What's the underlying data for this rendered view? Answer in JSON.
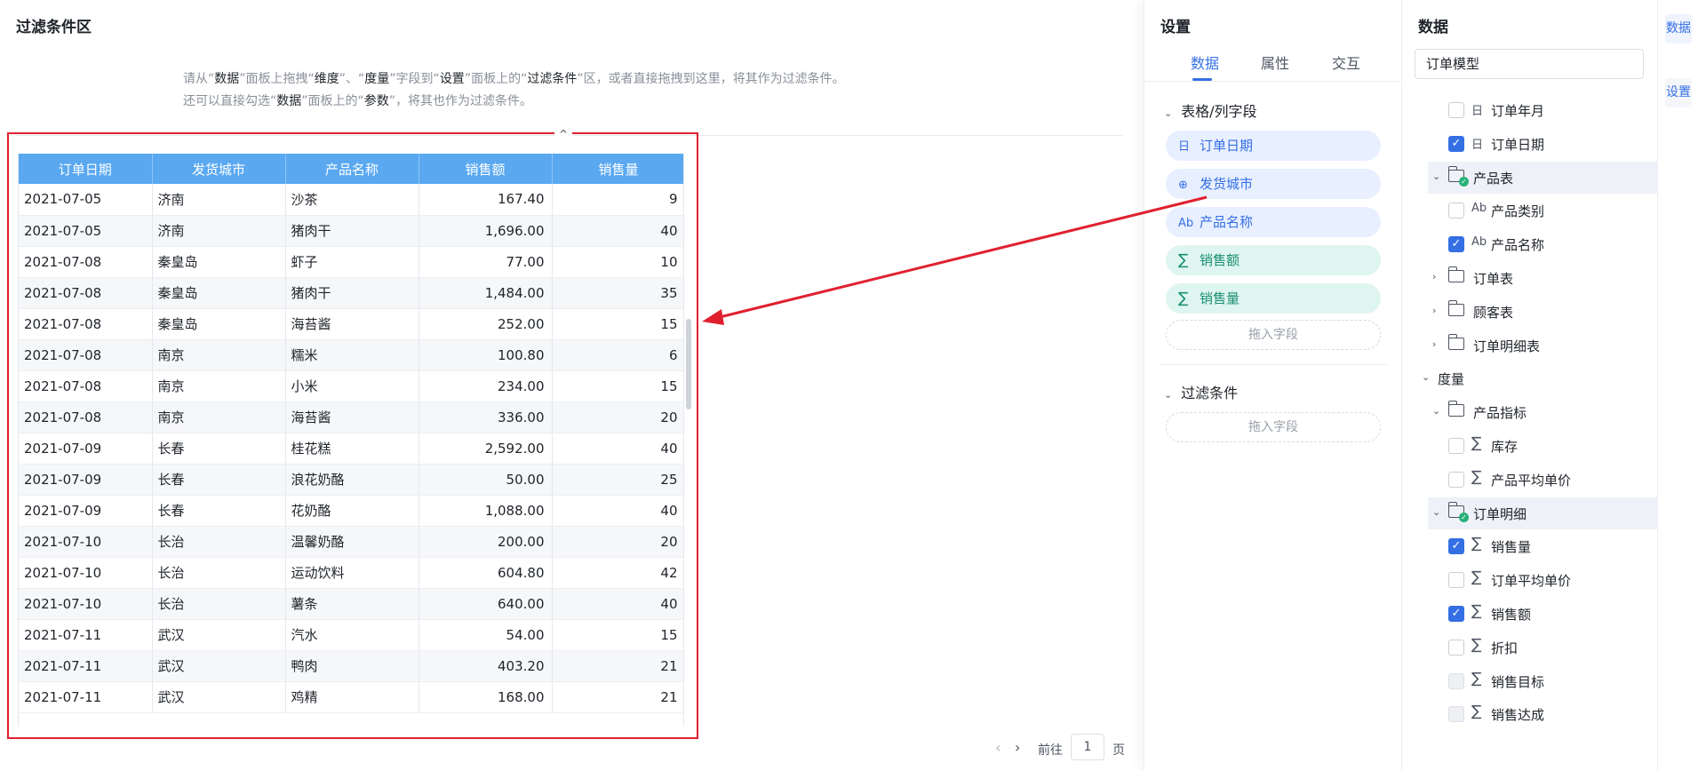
{
  "main": {
    "title": "过滤条件区",
    "hint_line1": {
      "p1": "请从“",
      "b1": "数据",
      "p2": "”面板上拖拽“",
      "b2": "维度",
      "p3": "”、“",
      "b3": "度量",
      "p4": "”字段到“",
      "b4": "设置",
      "p5": "”面板上的“",
      "b5": "过滤条件",
      "p6": "”区，或者直接拖拽到这里，将其作为过滤条件。"
    },
    "hint_line2": {
      "p1": "还可以直接勾选“",
      "b1": "数据",
      "p2": "”面板上的“",
      "b2": "参数",
      "p3": "”，将其也作为过滤条件。"
    },
    "collapse_glyph": "^",
    "table": {
      "columns": [
        "订单日期",
        "发货城市",
        "产品名称",
        "销售额",
        "销售量"
      ],
      "rows": [
        [
          "2021-07-05",
          "济南",
          "沙茶",
          "167.40",
          "9"
        ],
        [
          "2021-07-05",
          "济南",
          "猪肉干",
          "1,696.00",
          "40"
        ],
        [
          "2021-07-08",
          "秦皇岛",
          "虾子",
          "77.00",
          "10"
        ],
        [
          "2021-07-08",
          "秦皇岛",
          "猪肉干",
          "1,484.00",
          "35"
        ],
        [
          "2021-07-08",
          "秦皇岛",
          "海苔酱",
          "252.00",
          "15"
        ],
        [
          "2021-07-08",
          "南京",
          "糯米",
          "100.80",
          "6"
        ],
        [
          "2021-07-08",
          "南京",
          "小米",
          "234.00",
          "15"
        ],
        [
          "2021-07-08",
          "南京",
          "海苔酱",
          "336.00",
          "20"
        ],
        [
          "2021-07-09",
          "长春",
          "桂花糕",
          "2,592.00",
          "40"
        ],
        [
          "2021-07-09",
          "长春",
          "浪花奶酪",
          "50.00",
          "25"
        ],
        [
          "2021-07-09",
          "长春",
          "花奶酪",
          "1,088.00",
          "40"
        ],
        [
          "2021-07-10",
          "长治",
          "温馨奶酪",
          "200.00",
          "20"
        ],
        [
          "2021-07-10",
          "长治",
          "运动饮料",
          "604.80",
          "42"
        ],
        [
          "2021-07-10",
          "长治",
          "薯条",
          "640.00",
          "40"
        ],
        [
          "2021-07-11",
          "武汉",
          "汽水",
          "54.00",
          "15"
        ],
        [
          "2021-07-11",
          "武汉",
          "鸭肉",
          "403.20",
          "21"
        ],
        [
          "2021-07-11",
          "武汉",
          "鸡精",
          "168.00",
          "21"
        ]
      ]
    },
    "pager": {
      "prev": "‹",
      "next": "›",
      "label": "前往",
      "value": "1",
      "unit": "页"
    }
  },
  "settings": {
    "title": "设置",
    "tabs": [
      "数据",
      "属性",
      "交互"
    ],
    "section_fields": "表格/列字段",
    "fields": [
      {
        "icon": "日",
        "label": "订单日期",
        "kind": "dim"
      },
      {
        "icon": "⊕",
        "label": "发货城市",
        "kind": "dim"
      },
      {
        "icon": "Ab",
        "label": "产品名称",
        "kind": "dim"
      },
      {
        "icon": "∑",
        "label": "销售额",
        "kind": "meas"
      },
      {
        "icon": "∑",
        "label": "销售量",
        "kind": "meas"
      }
    ],
    "drop_label": "拖入字段",
    "section_filter": "过滤条件",
    "filter_drop_label": "拖入字段"
  },
  "data": {
    "title": "数据",
    "model": "订单模型",
    "tree": [
      {
        "label": "订单年月",
        "icon": "日",
        "check": "off"
      },
      {
        "label": "订单日期",
        "icon": "日",
        "check": "on"
      },
      {
        "label": "产品表",
        "folder": true,
        "expanded": true,
        "tick": true
      },
      {
        "label": "产品类别",
        "icon": "Ab",
        "check": "off"
      },
      {
        "label": "产品名称",
        "icon": "Ab",
        "check": "on"
      },
      {
        "label": "订单表",
        "folder": true,
        "expanded": false
      },
      {
        "label": "顾客表",
        "folder": true,
        "expanded": false
      },
      {
        "label": "订单明细表",
        "folder": true,
        "expanded": false
      },
      {
        "label": "度量",
        "group": true
      },
      {
        "label": "产品指标",
        "folder": true,
        "expanded": true
      },
      {
        "label": "库存",
        "icon": "∑",
        "check": "off"
      },
      {
        "label": "产品平均单价",
        "icon": "∑",
        "check": "off"
      },
      {
        "label": "订单明细",
        "folder": true,
        "expanded": true,
        "tick": true
      },
      {
        "label": "销售量",
        "icon": "∑",
        "check": "on"
      },
      {
        "label": "订单平均单价",
        "icon": "∑",
        "check": "off"
      },
      {
        "label": "销售额",
        "icon": "∑",
        "check": "on"
      },
      {
        "label": "折扣",
        "icon": "∑",
        "check": "off"
      },
      {
        "label": "销售目标",
        "icon": "∑",
        "check": "dis"
      },
      {
        "label": "销售达成",
        "icon": "∑",
        "check": "dis"
      }
    ]
  },
  "rail": {
    "tab_data": "数据",
    "tab_settings": "设置"
  },
  "colors": {
    "accent": "#3470e4",
    "header": "#5aa8f0",
    "highlight_frame": "#e0202f",
    "measure_pill": "#dff5f0"
  }
}
